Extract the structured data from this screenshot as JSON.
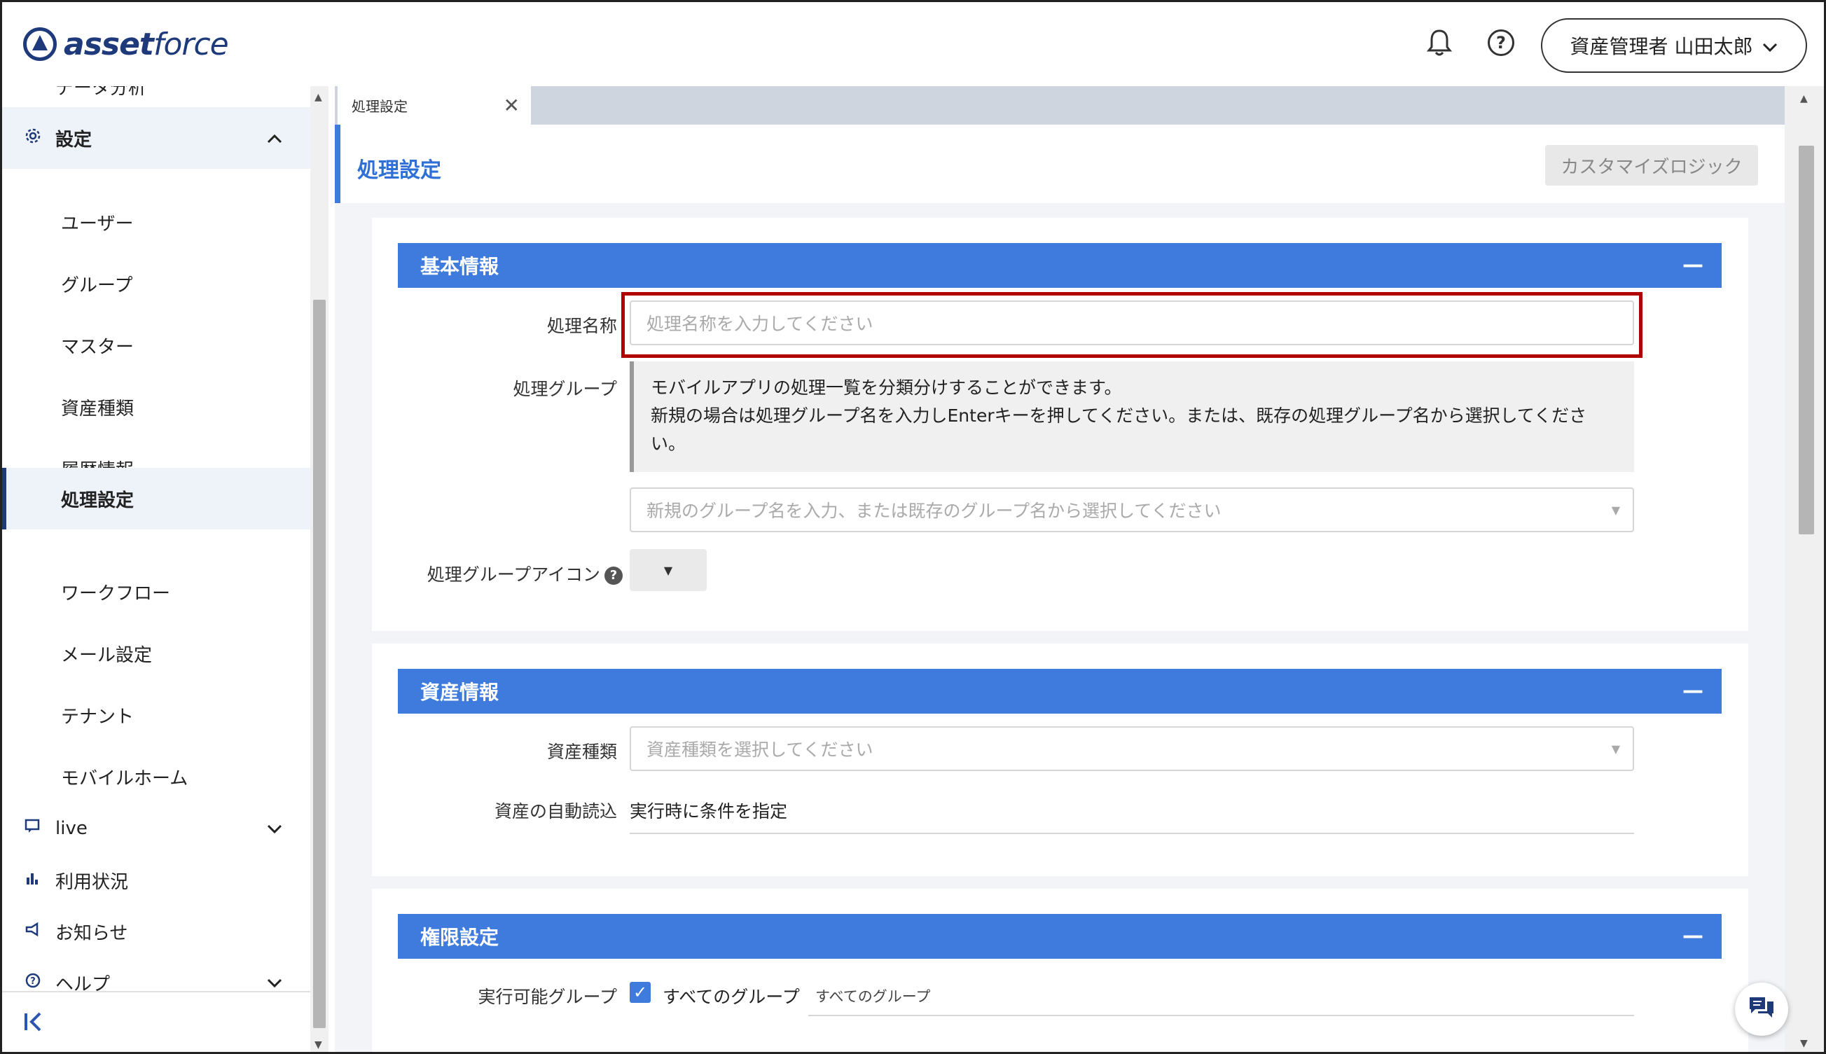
{
  "header": {
    "logo_prefix": "asset",
    "logo_suffix": "force",
    "user_name": "資産管理者 山田太郎",
    "help_glyph": "?"
  },
  "sidebar": {
    "top_partial": "データ分析",
    "settings_label": "設定",
    "sub_items": [
      "ユーザー",
      "グループ",
      "マスター",
      "資産種類",
      "履歴情報",
      "処理設定",
      "ワークフロー",
      "メール設定",
      "テナント",
      "モバイルホーム"
    ],
    "active_item": "処理設定",
    "live_label": "live",
    "usage_label": "利用状況",
    "notice_label": "お知らせ",
    "help_label": "ヘルプ"
  },
  "tabs": [
    {
      "label": "処理設定"
    }
  ],
  "page": {
    "title": "処理設定",
    "customize_button": "カスタマイズロジック"
  },
  "basic_info": {
    "header": "基本情報",
    "name_label": "処理名称",
    "name_placeholder": "処理名称を入力してください",
    "group_label": "処理グループ",
    "group_info_line1": "モバイルアプリの処理一覧を分類分けすることができます。",
    "group_info_line2": "新規の場合は処理グループ名を入力しEnterキーを押してください。または、既存の処理グループ名から選択してくださ",
    "group_info_line3": "い。",
    "group_placeholder": "新規のグループ名を入力、または既存のグループ名から選択してください",
    "icon_label": "処理グループアイコン"
  },
  "asset_info": {
    "header": "資産情報",
    "type_label": "資産種類",
    "type_placeholder": "資産種類を選択してください",
    "auto_read_label": "資産の自動読込",
    "auto_read_value": "実行時に条件を指定"
  },
  "permission": {
    "header": "権限設定",
    "exec_group_label": "実行可能グループ",
    "all_groups_label": "すべてのグループ",
    "all_groups_value": "すべてのグループ"
  },
  "colors": {
    "accent": "#3e7bdc",
    "brand": "#1e3a7a",
    "highlight": "#b00000"
  }
}
